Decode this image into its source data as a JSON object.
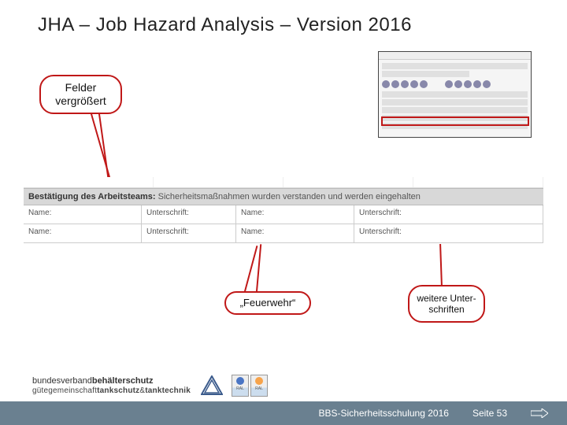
{
  "title": "JHA – Job Hazard Analysis – Version 2016",
  "callouts": {
    "felder": "Felder\nvergrößert",
    "feuerwehr": "„Feuerwehr“",
    "weitere": "weitere Unter-schriften"
  },
  "form": {
    "header_bold": "Bestätigung des Arbeitsteams:",
    "header_rest": " Sicherheitsmaßnahmen wurden verstanden und werden eingehalten",
    "name_label": "Name:",
    "sig_label": "Unterschrift:"
  },
  "logos": {
    "bv_line1_a": "bundesverband",
    "bv_line1_b": "behälterschutz",
    "guete_a": "gütegemeinschaft",
    "guete_b": "tankschutz",
    "guete_c": "&",
    "guete_d": "tanktechnik"
  },
  "footer": {
    "training": "BBS-Sicherheitsschulung 2016",
    "page_label": "Seite",
    "page_num": "53"
  }
}
